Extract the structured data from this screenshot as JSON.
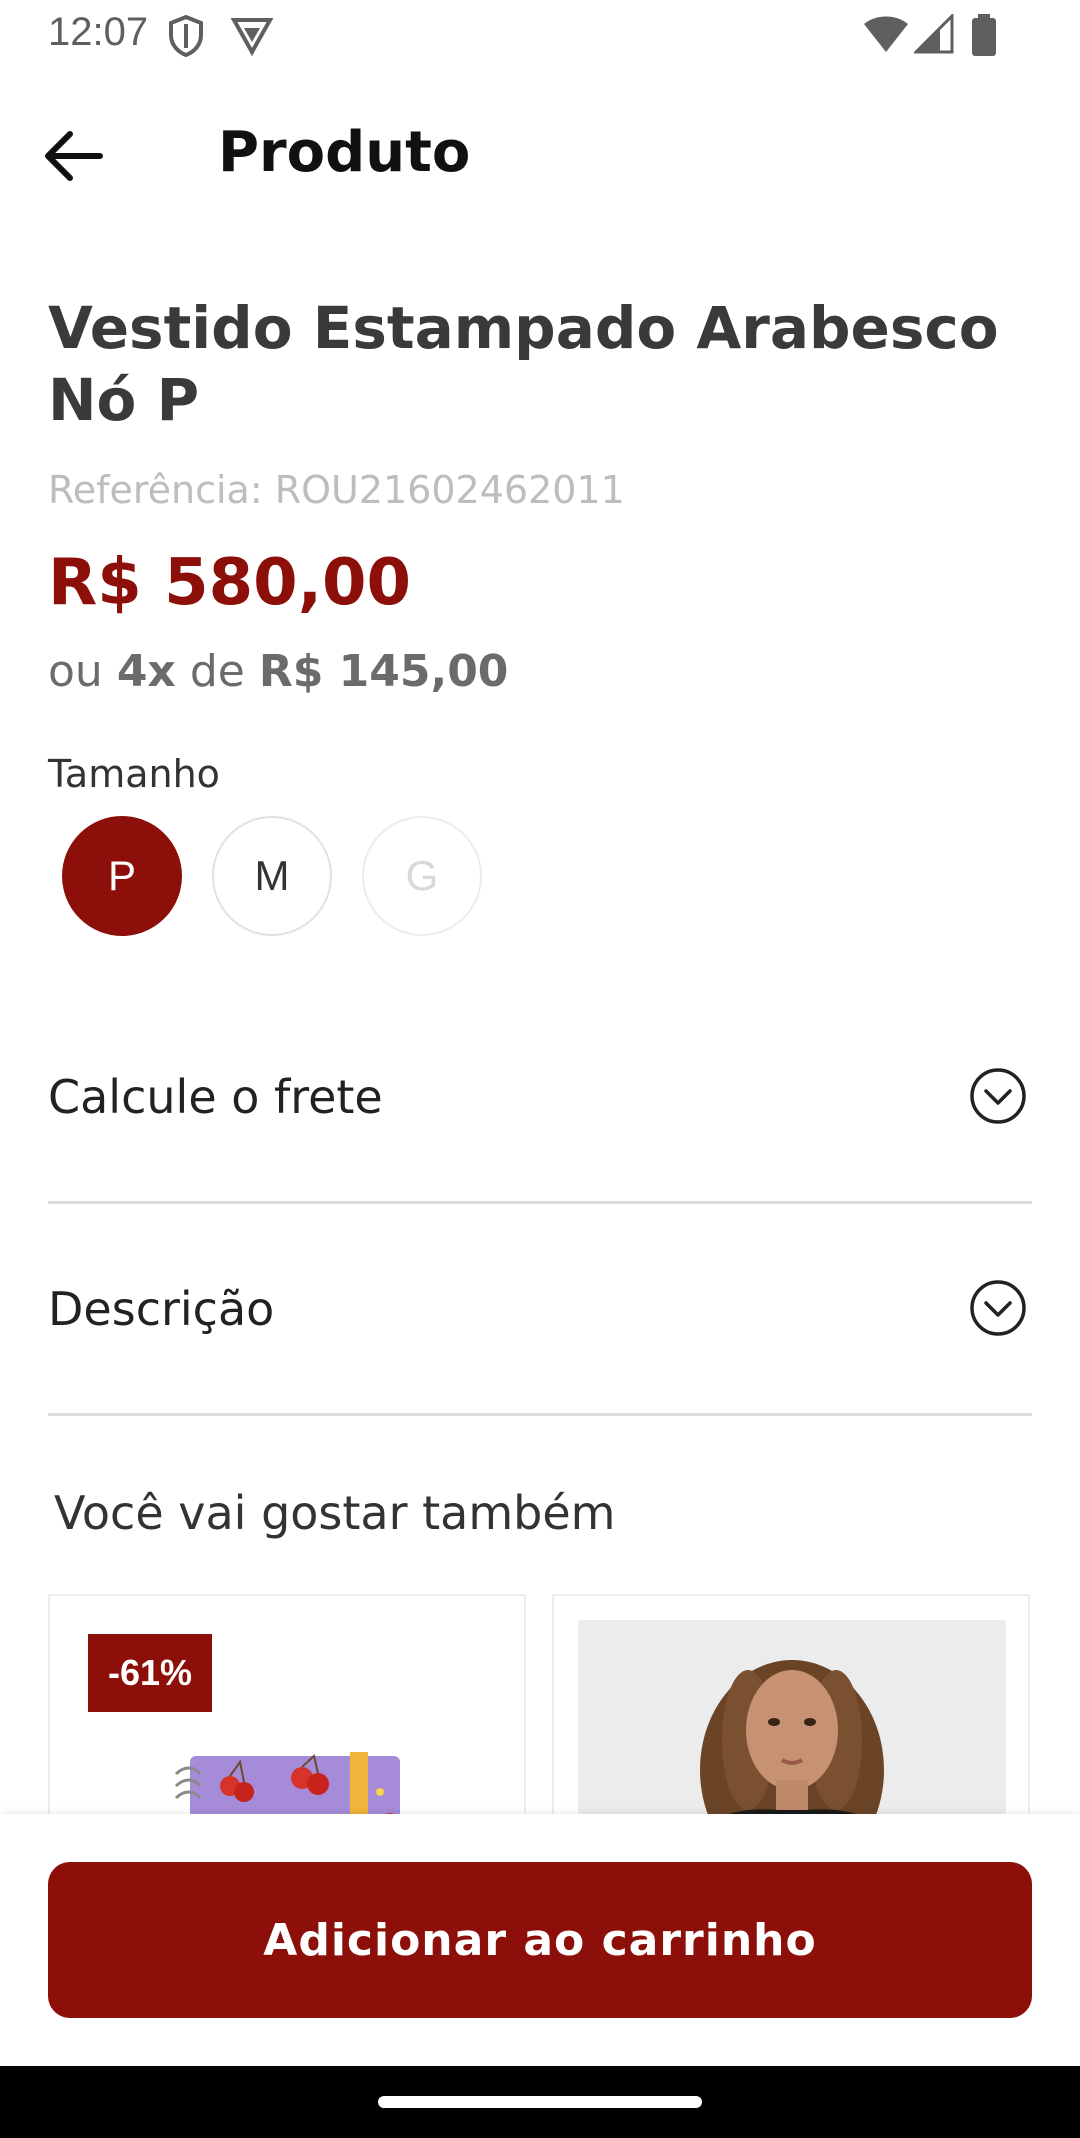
{
  "status_bar": {
    "time": "12:07",
    "icons": [
      "shield-icon",
      "vpn-badge-icon",
      "wifi-icon",
      "signal-icon",
      "battery-icon"
    ]
  },
  "header": {
    "title": "Produto",
    "back_icon": "arrow-left-icon"
  },
  "product": {
    "title": "Vestido Estampado Arabesco Nó P",
    "reference": "Referência: ROU21602462011",
    "price": "R$ 580,00",
    "installments": {
      "prefix": "ou",
      "count": "4x",
      "middle": "de",
      "amount": "R$ 145,00"
    }
  },
  "size": {
    "label": "Tamanho",
    "options": [
      {
        "label": "P",
        "state": "selected"
      },
      {
        "label": "M",
        "state": "available"
      },
      {
        "label": "G",
        "state": "unavailable"
      }
    ]
  },
  "accordions": {
    "shipping": {
      "label": "Calcule o frete",
      "icon": "chevron-down-circle-icon"
    },
    "description": {
      "label": "Descrição",
      "icon": "chevron-down-circle-icon"
    }
  },
  "recommendations": {
    "title": "Você vai gostar também",
    "items": [
      {
        "badge": "-61%",
        "image": "cherry-notebook-image"
      },
      {
        "badge": "",
        "image": "woman-portrait-image"
      }
    ]
  },
  "cart": {
    "button_label": "Adicionar ao carrinho"
  },
  "colors": {
    "brand": "#8c0f0a",
    "muted_text": "#6b6b6b",
    "divider": "#dcdcdc"
  }
}
